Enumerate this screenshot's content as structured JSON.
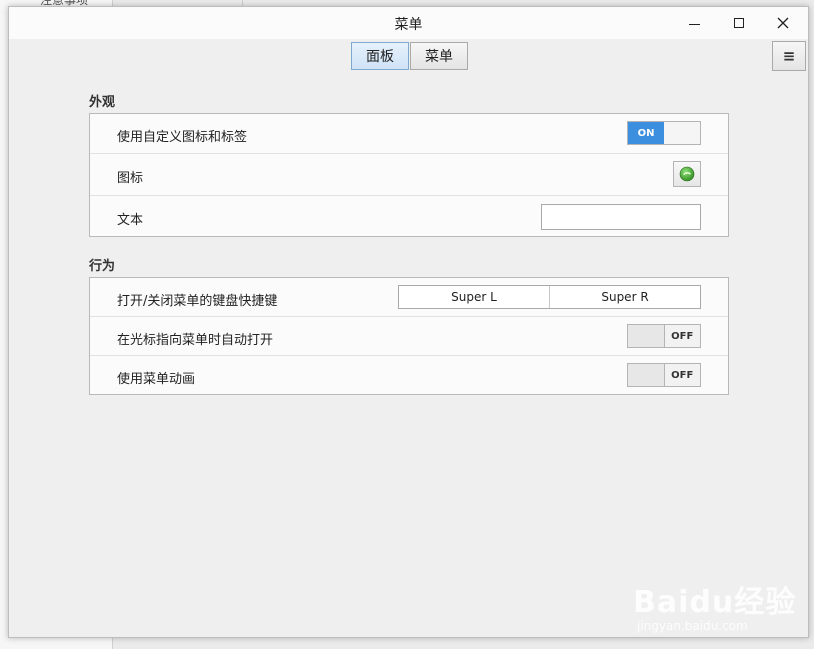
{
  "background": {
    "sidebar_text": "注意事项"
  },
  "window": {
    "title": "菜单",
    "controls": {
      "minimize": "minimize-icon",
      "maximize": "maximize-icon",
      "close": "close-icon"
    }
  },
  "tabs": [
    {
      "label": "面板",
      "active": true
    },
    {
      "label": "菜单",
      "active": false
    }
  ],
  "menu_button": {
    "icon": "hamburger-icon",
    "glyph": "≡"
  },
  "appearance": {
    "title": "外观",
    "custom_icon_label": "使用自定义图标和标签",
    "custom_icon_toggle": "ON",
    "icon_label": "图标",
    "text_label": "文本",
    "text_value": ""
  },
  "behavior": {
    "title": "行为",
    "shortcut_label": "打开/关闭菜单的键盘快捷键",
    "shortcut_keys": [
      "Super L",
      "Super R"
    ],
    "hover_open_label": "在光标指向菜单时自动打开",
    "hover_open_toggle": "OFF",
    "animation_label": "使用菜单动画",
    "animation_toggle": "OFF"
  },
  "watermark": {
    "text": "Baidu经验",
    "url": "jingyan.baidu.com"
  },
  "colors": {
    "accent": "#3c8fde",
    "window_bg": "#efefef",
    "panel_bg": "#fbfbfb"
  }
}
